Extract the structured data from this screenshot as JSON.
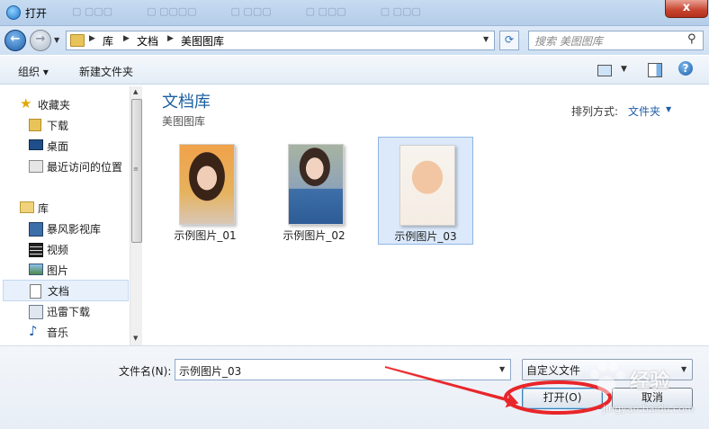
{
  "window": {
    "title": "打开",
    "close_label": "x"
  },
  "nav": {
    "breadcrumbs": [
      "库",
      "文档",
      "美图图库"
    ],
    "search_placeholder": "搜索 美图图库"
  },
  "toolbar": {
    "organize": "组织 ▾",
    "new_folder": "新建文件夹"
  },
  "sidebar": {
    "favorites": {
      "label": "收藏夹",
      "items": [
        "下载",
        "桌面",
        "最近访问的位置"
      ]
    },
    "libraries": {
      "label": "库",
      "items": [
        "暴风影视库",
        "视频",
        "图片",
        "文档",
        "迅雷下载",
        "音乐"
      ]
    },
    "selected": "文档"
  },
  "main": {
    "title": "文档库",
    "subtitle": "美图图库",
    "arrange_label": "排列方式:",
    "arrange_value": "文件夹",
    "files": [
      {
        "name": "示例图片_01"
      },
      {
        "name": "示例图片_02"
      },
      {
        "name": "示例图片_03",
        "selected": true
      }
    ]
  },
  "footer": {
    "filename_label": "文件名(N):",
    "filename_value": "示例图片_03",
    "filter_value": "自定义文件",
    "open_label": "打开(O)",
    "cancel_label": "取消"
  },
  "watermark": {
    "text": "经验",
    "url": "jingyan.baidu.com"
  },
  "colors": {
    "accent": "#1b5f9f",
    "annotation": "#e8262a",
    "selection": "#dbe9fb"
  }
}
